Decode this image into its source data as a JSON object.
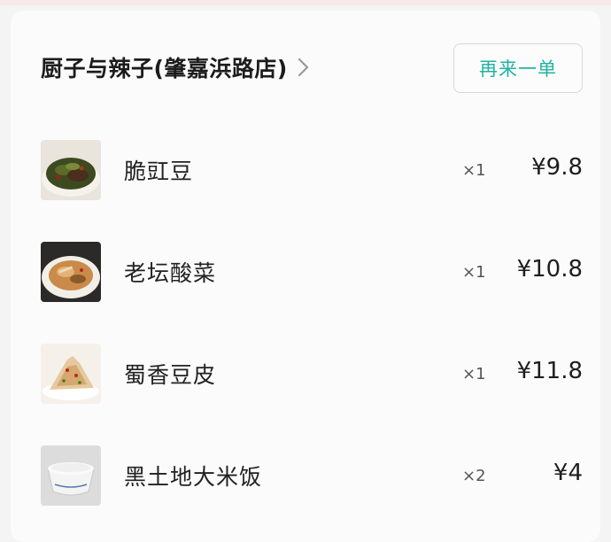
{
  "header": {
    "shop_name": "厨子与辣子(肇嘉浜路店)",
    "reorder_label": "再来一单"
  },
  "colors": {
    "accent": "#21b3a1",
    "card_background": "#fbfbfb",
    "page_background": "#f4f4f4"
  },
  "icons": {
    "shop_link": "chevron-right-icon"
  },
  "items": [
    {
      "name": "脆豇豆",
      "qty": "×1",
      "price": "¥9.8",
      "thumbnail": "crispy-cowpea-dish"
    },
    {
      "name": "老坛酸菜",
      "qty": "×1",
      "price": "¥10.8",
      "thumbnail": "pickled-cabbage-dish"
    },
    {
      "name": "蜀香豆皮",
      "qty": "×1",
      "price": "¥11.8",
      "thumbnail": "tofu-skin-dish"
    },
    {
      "name": "黑土地大米饭",
      "qty": "×2",
      "price": "¥4",
      "thumbnail": "rice-bowl"
    }
  ]
}
